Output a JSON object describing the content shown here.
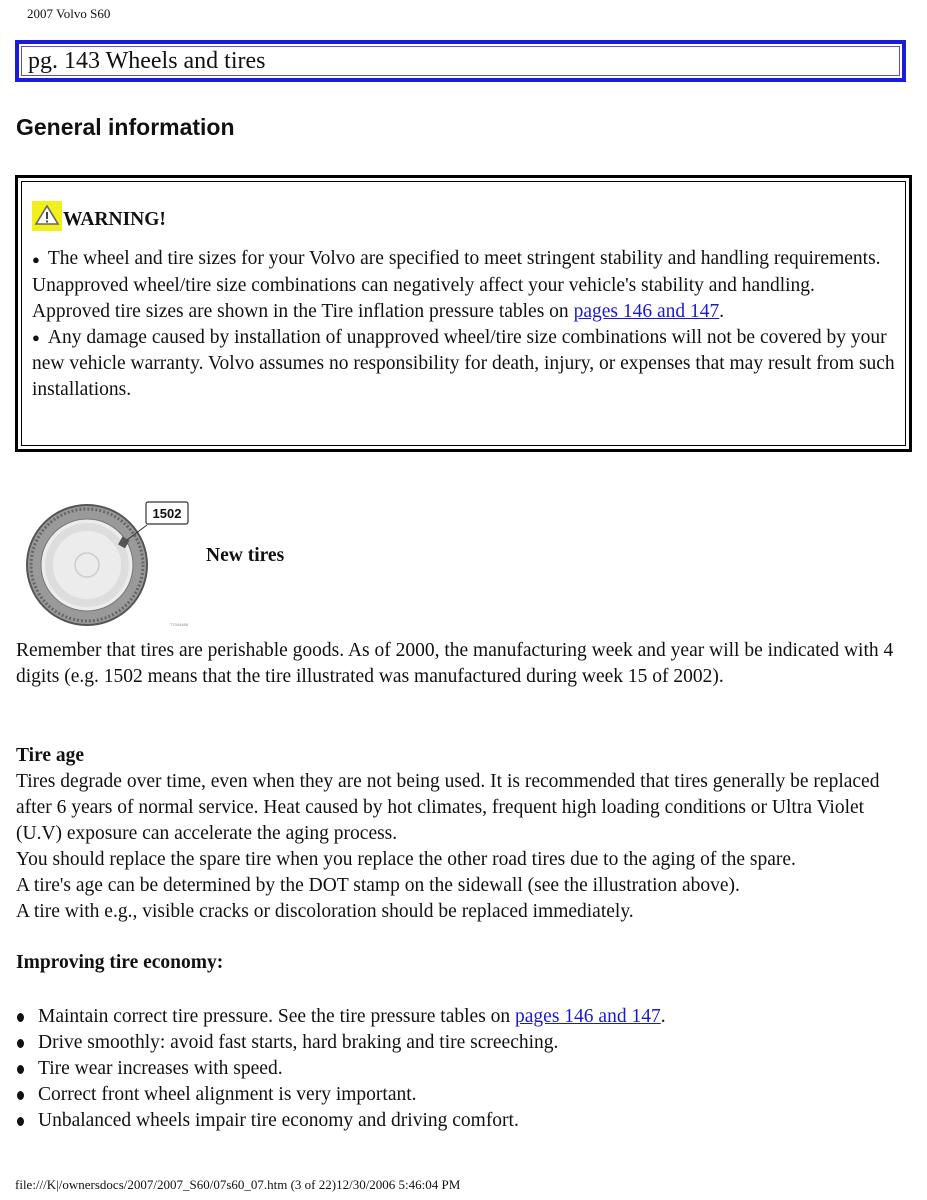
{
  "document": {
    "title": "2007 Volvo S60",
    "page_banner": "pg. 143 Wheels and tires",
    "section_heading": "General information"
  },
  "warning": {
    "icon": "warning-triangle-icon",
    "icon_bg_color": "#f2ef1e",
    "title": "WARNING!",
    "items": [
      {
        "text_before": "The wheel and tire sizes for your Volvo are specified to meet stringent stability and handling requirements. Unapproved wheel/tire size combinations can negatively affect your vehicle's stability and handling. Approved tire sizes are shown in the Tire inflation pressure tables on ",
        "link": "pages 146 and 147",
        "text_after": "."
      },
      {
        "text_before": "Any damage caused by installation of unapproved wheel/tire size combinations will not be covered by your new vehicle warranty. Volvo assumes no responsibility for death, injury, or expenses that may result from such installations.",
        "link": "",
        "text_after": ""
      }
    ]
  },
  "new_tires": {
    "figure_label": "1502",
    "figure_code": "T7004488",
    "title": "New tires",
    "paragraph": "Remember that tires are perishable goods. As of 2000, the manufacturing week and year will be indicated with 4 digits (e.g. 1502 means that the tire illustrated was manufactured during week 15 of 2002)."
  },
  "tire_age": {
    "title": "Tire age",
    "lines": [
      "Tires degrade over time, even when they are not being used. It is recommended that tires generally be replaced after 6 years of normal service. Heat caused by hot climates, frequent high loading conditions or Ultra Violet (U.V) exposure can accelerate the aging process.",
      "You should replace the spare tire when you replace the other road tires due to the aging of the spare.",
      "A tire's age can be determined by the DOT stamp on the sidewall (see the illustration above).",
      "A tire with e.g., visible cracks or discoloration should be replaced immediately."
    ]
  },
  "economy": {
    "title": "Improving tire economy:",
    "items": [
      {
        "text": "Maintain correct tire pressure. See the tire pressure tables on ",
        "link": "pages 146 and 147",
        "after": "."
      },
      {
        "text": "Drive smoothly: avoid fast starts, hard braking and tire screeching.",
        "link": "",
        "after": ""
      },
      {
        "text": "Tire wear increases with speed.",
        "link": "",
        "after": ""
      },
      {
        "text": "Correct front wheel alignment is very important.",
        "link": "",
        "after": ""
      },
      {
        "text": "Unbalanced wheels impair tire economy and driving comfort.",
        "link": "",
        "after": ""
      }
    ]
  },
  "footer": "file:///K|/ownersdocs/2007/2007_S60/07s60_07.htm (3 of 22)12/30/2006 5:46:04 PM",
  "colors": {
    "banner_border": "#1a1ae0",
    "link": "#1a1acc"
  }
}
